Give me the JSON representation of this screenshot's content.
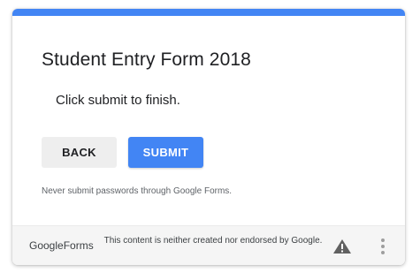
{
  "form": {
    "title": "Student Entry Form 2018",
    "message": "Click submit to finish.",
    "back_label": "BACK",
    "submit_label": "SUBMIT",
    "password_warning": "Never submit passwords through Google Forms."
  },
  "footer": {
    "brand_google": "Google",
    "brand_forms": "Forms",
    "disclaimer": "This content is neither created nor endorsed by Google.",
    "report_icon": "warning-triangle-icon",
    "menu_icon": "more-vertical-icon"
  },
  "colors": {
    "accent": "#4285f4",
    "back_button_bg": "#eeeeee",
    "footer_bg": "#f5f5f5"
  }
}
